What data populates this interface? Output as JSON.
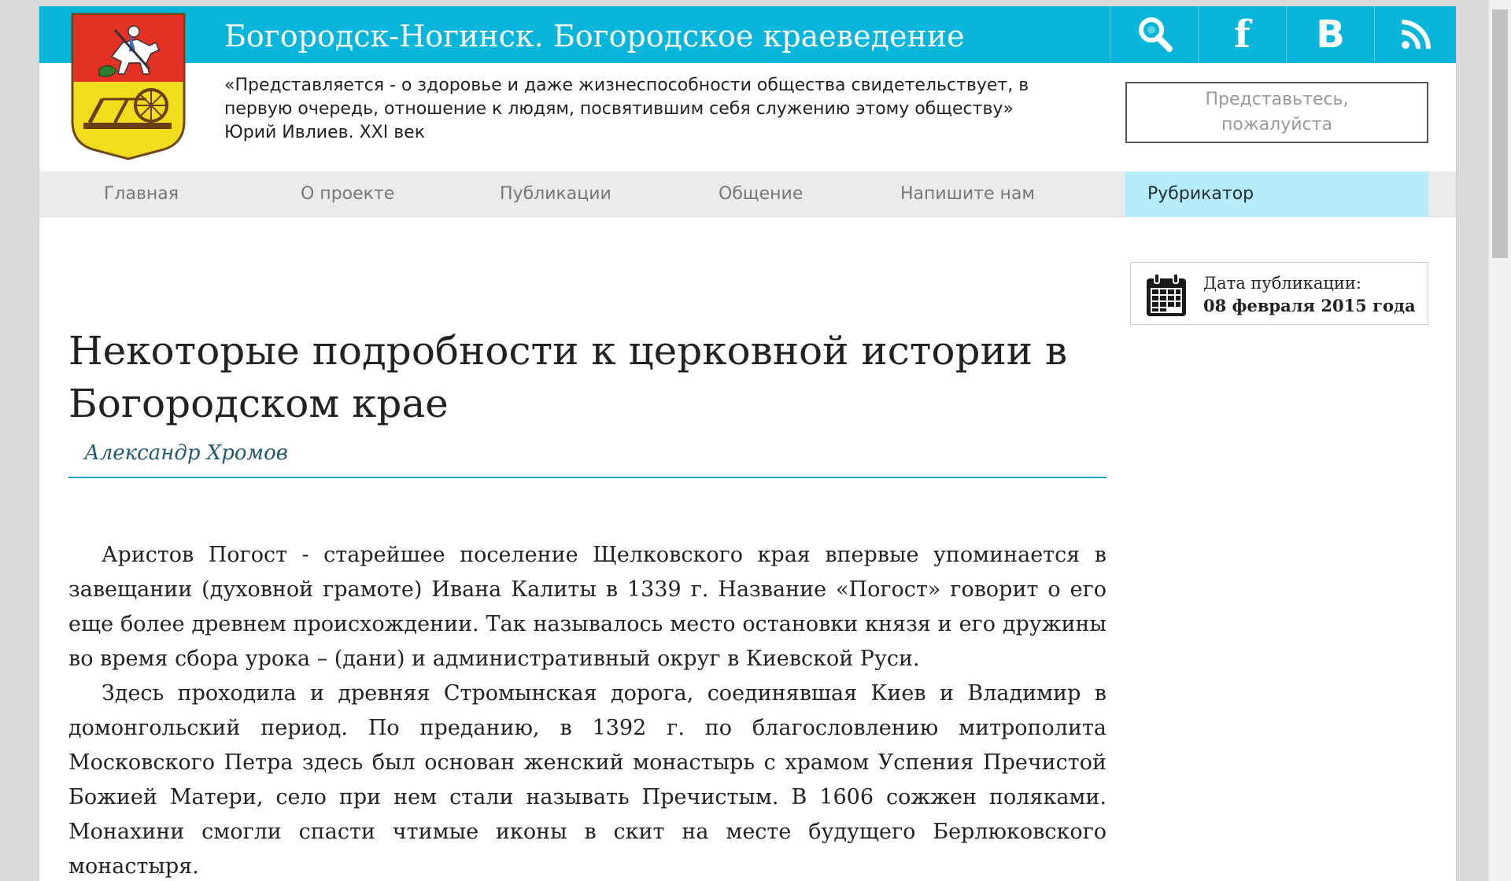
{
  "header": {
    "site_title": "Богородск-Ногинск. Богородское краеведение",
    "quote_line1": "«Представляется - о здоровье и даже жизнеспособности общества свидетельствует, в",
    "quote_line2": "первую очередь, отношение к людям, посвятившим себя служению этому обществу»",
    "quote_line3": "Юрий Ивлиев. XXI век",
    "login_line1": "Представьтесь,",
    "login_line2": "пожалуйста",
    "icons": {
      "search": "search-icon",
      "facebook": "f",
      "vkontakte": "В",
      "rss": "rss-icon"
    },
    "colors": {
      "accent": "#08b6dc",
      "rubricator_bg": "#b5ebfa"
    }
  },
  "nav": {
    "items": [
      "Главная",
      "О проекте",
      "Публикации",
      "Общение",
      "Напишите нам"
    ],
    "rubricator": "Рубрикатор"
  },
  "publication": {
    "date_label": "Дата публикации:",
    "date_value": "08 февраля 2015 года"
  },
  "article": {
    "title": "Некоторые подробности к церковной истории в Богородском крае",
    "author": "Александр Хромов",
    "paragraphs": [
      "Аристов Погост - старейшее поселение Щелковского края впервые упоминается в завещании (духовной грамоте) Ивана Калиты в 1339 г. Название «Погост» говорит о его еще более древнем происхождении. Так называлось место остановки князя и его дружины во время сбора урока – (дани) и административный округ в Киевской Руси.",
      "Здесь проходила и древняя Стромынская дорога, соединявшая Киев и Владимир в домонгольский период. По преданию, в 1392 г. по благословлению митрополита Московского Петра здесь был основан женский монастырь с храмом Успения Пречистой Божией Матери, село при нем стали называть Пречистым. В 1606 сожжен поляками. Монахини смогли спасти чтимые иконы в скит на месте будущего Берлюковского монастыря."
    ]
  }
}
